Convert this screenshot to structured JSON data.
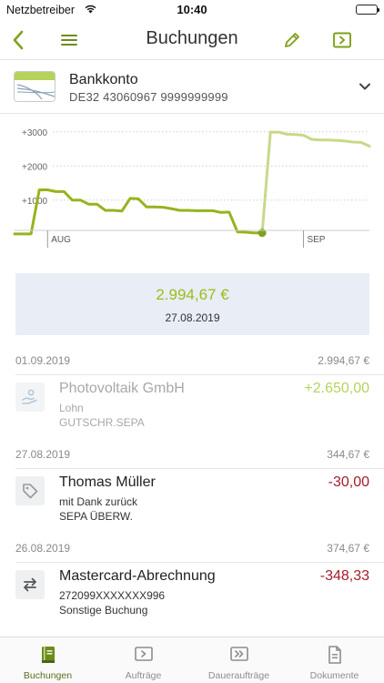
{
  "status": {
    "carrier": "Netzbetreiber",
    "time": "10:40"
  },
  "nav": {
    "title": "Buchungen"
  },
  "account": {
    "name": "Bankkonto",
    "iban": "DE32 43060967 9999999999"
  },
  "chart_data": {
    "type": "line",
    "y_tick_labels": [
      "+3000",
      "+2000",
      "+1000"
    ],
    "y_ticks": [
      3000,
      2000,
      1000
    ],
    "x_tick_labels": [
      "AUG",
      "SEP"
    ],
    "ylim": [
      -500,
      3500
    ],
    "series": [
      {
        "values": [
          [
            0,
            10
          ],
          [
            1,
            10
          ],
          [
            2,
            10
          ],
          [
            3,
            1300
          ],
          [
            4,
            1300
          ],
          [
            5,
            1250
          ],
          [
            6,
            1250
          ],
          [
            7,
            1000
          ],
          [
            8,
            1000
          ],
          [
            9,
            880
          ],
          [
            10,
            880
          ],
          [
            11,
            700
          ],
          [
            12,
            700
          ],
          [
            13,
            680
          ],
          [
            14,
            1050
          ],
          [
            15,
            1040
          ],
          [
            16,
            800
          ],
          [
            17,
            800
          ],
          [
            18,
            790
          ],
          [
            19,
            750
          ],
          [
            20,
            700
          ],
          [
            21,
            700
          ],
          [
            22,
            690
          ],
          [
            23,
            690
          ],
          [
            24,
            690
          ],
          [
            25,
            640
          ],
          [
            26,
            650
          ],
          [
            27,
            70
          ],
          [
            28,
            60
          ],
          [
            29,
            40
          ],
          [
            30,
            40
          ]
        ],
        "color": "#96b41e"
      },
      {
        "values": [
          [
            30,
            40
          ],
          [
            31,
            2990
          ],
          [
            32,
            2990
          ],
          [
            33,
            2930
          ],
          [
            34,
            2920
          ],
          [
            35,
            2900
          ],
          [
            36,
            2780
          ],
          [
            37,
            2760
          ],
          [
            38,
            2760
          ],
          [
            39,
            2750
          ],
          [
            40,
            2730
          ],
          [
            41,
            2700
          ],
          [
            42,
            2690
          ],
          [
            43,
            2580
          ]
        ],
        "color": "#c6d98a"
      }
    ],
    "marker": [
      30,
      40
    ],
    "x_tick_positions": [
      4,
      35
    ],
    "xlim": [
      0,
      43
    ],
    "grid": true
  },
  "balance": {
    "amount": "2.994,67 €",
    "date": "27.08.2019"
  },
  "days": [
    {
      "date": "01.09.2019",
      "balance": "2.994,67 €"
    },
    {
      "date": "27.08.2019",
      "balance": "344,67 €"
    },
    {
      "date": "26.08.2019",
      "balance": "374,67 €"
    }
  ],
  "transactions": [
    {
      "name": "Photovoltaik GmbH",
      "purpose": "Lohn",
      "type": "GUTSCHR.SEPA",
      "amount": "+2.650,00",
      "amount_color": "#b5d35a",
      "icon": "income-icon"
    },
    {
      "name": "Thomas Müller",
      "purpose": "mit Dank zurück",
      "type": "SEPA ÜBERW.",
      "amount": "-30,00",
      "amount_color": "#a51c2a",
      "icon": "tag-icon"
    },
    {
      "name": "Mastercard-Abrechnung",
      "purpose": "272099XXXXXXX996",
      "type": "Sonstige Buchung",
      "amount": "-348,33",
      "amount_color": "#a51c2a",
      "icon": "transfer-icon"
    }
  ],
  "tabs": [
    {
      "label": "Buchungen",
      "icon": "book-icon",
      "active": true
    },
    {
      "label": "Aufträge",
      "icon": "order-icon",
      "active": false
    },
    {
      "label": "Daueraufträge",
      "icon": "standing-order-icon",
      "active": false
    },
    {
      "label": "Dokumente",
      "icon": "document-icon",
      "active": false
    }
  ],
  "colors": {
    "accent": "#7fa21a",
    "positive": "#9cbd1a",
    "negative": "#a51c2a",
    "balance_bg": "#e8edf6"
  }
}
